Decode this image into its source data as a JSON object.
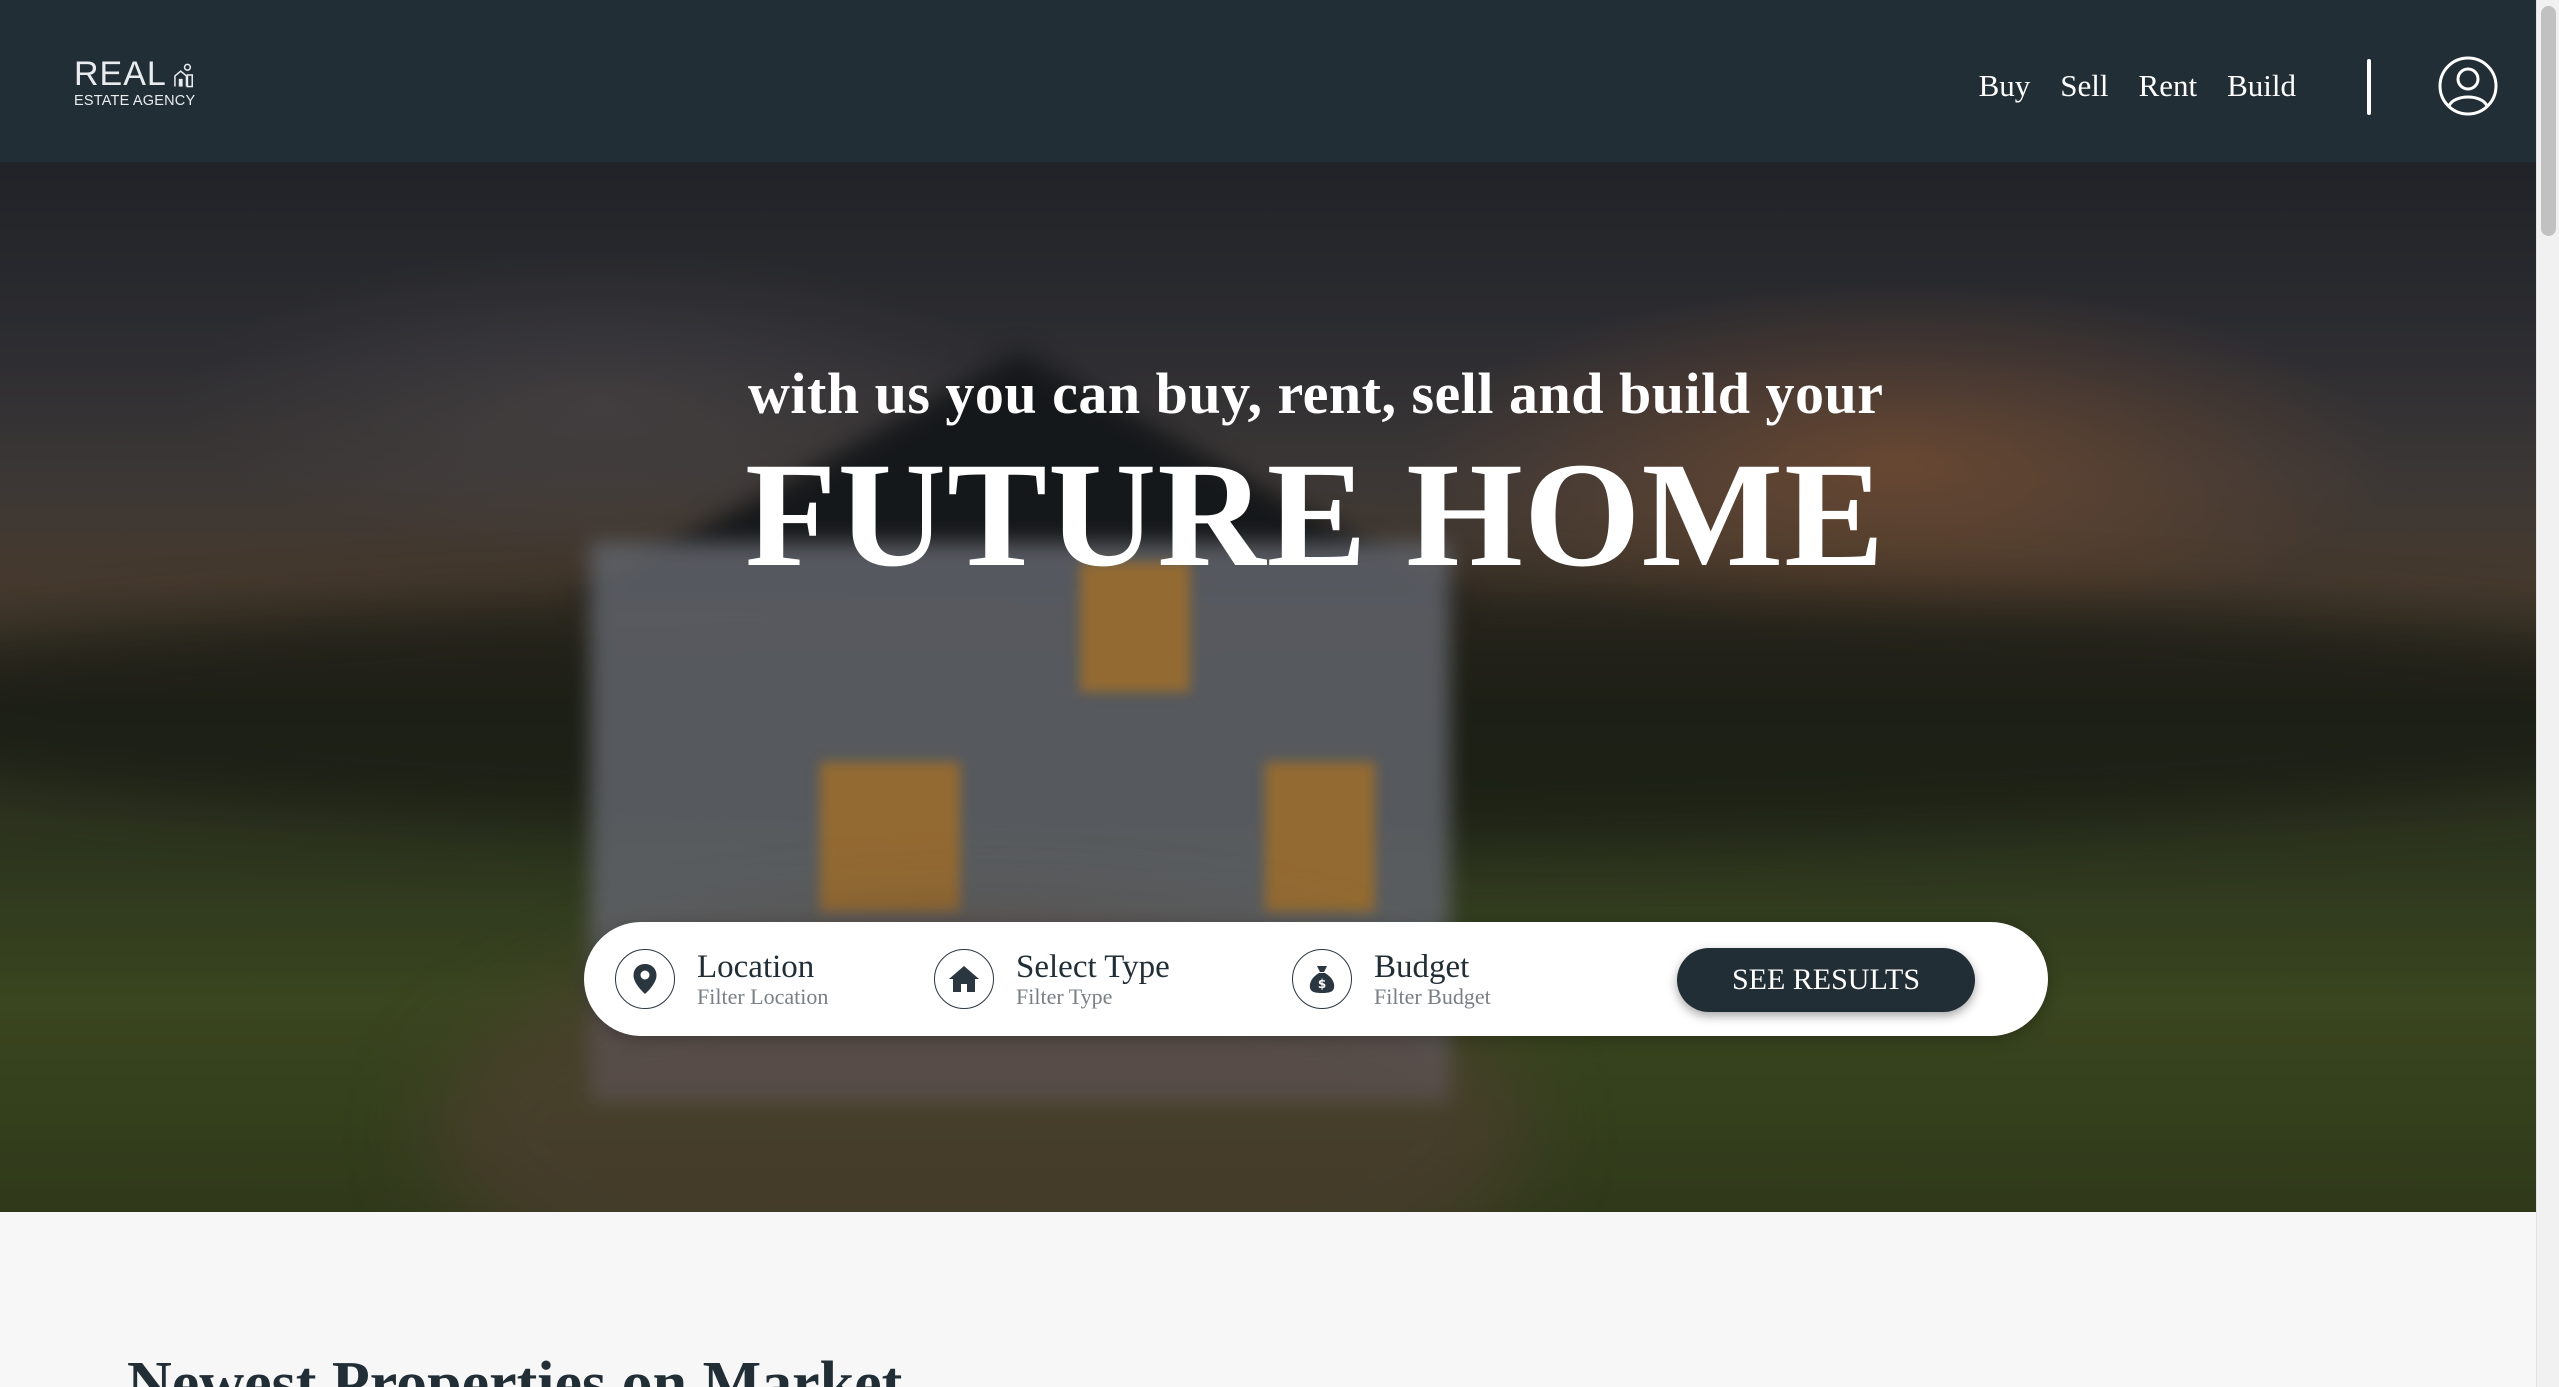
{
  "header": {
    "logo_top": "REAL",
    "logo_bottom": "ESTATE AGENCY",
    "nav": [
      "Buy",
      "Sell",
      "Rent",
      "Build"
    ],
    "account_icon": "user-circle-icon"
  },
  "hero": {
    "subtitle": "with us you can buy, rent, sell and build your",
    "title": "FUTURE HOME"
  },
  "search": {
    "filters": [
      {
        "icon": "location-pin-icon",
        "label": "Location",
        "sub": "Filter Location"
      },
      {
        "icon": "house-icon",
        "label": "Select Type",
        "sub": "Filter Type"
      },
      {
        "icon": "money-bag-icon",
        "label": "Budget",
        "sub": "Filter Budget"
      }
    ],
    "button": "SEE RESULTS"
  },
  "main": {
    "section_title": "Newest Properties on Market"
  },
  "colors": {
    "header_bg": "#222e36",
    "accent": "#222e36",
    "page_bg": "#f7f7f7"
  }
}
